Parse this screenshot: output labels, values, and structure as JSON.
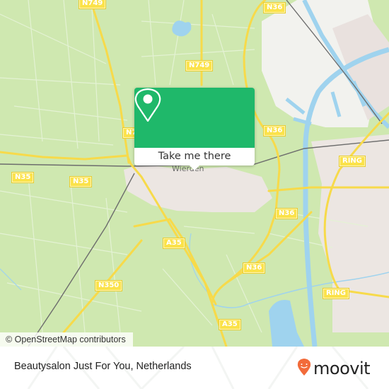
{
  "map": {
    "attribution": "© OpenStreetMap contributors",
    "town_label": "Wierden",
    "road_labels": [
      {
        "id": "n749-top-left",
        "text": "N749"
      },
      {
        "id": "n749-center",
        "text": "N749"
      },
      {
        "id": "n36-top",
        "text": "N36"
      },
      {
        "id": "n7-left",
        "text": "N7"
      },
      {
        "id": "n36-mid",
        "text": "N36"
      },
      {
        "id": "n35-left",
        "text": "N35"
      },
      {
        "id": "n35-center",
        "text": "N35"
      },
      {
        "id": "ring-right",
        "text": "RING"
      },
      {
        "id": "n36-lower",
        "text": "N36"
      },
      {
        "id": "a35-center",
        "text": "A35"
      },
      {
        "id": "n36-south",
        "text": "N36"
      },
      {
        "id": "n350",
        "text": "N350"
      },
      {
        "id": "ring-lower",
        "text": "RING"
      },
      {
        "id": "a35-south",
        "text": "A35"
      }
    ],
    "colors": {
      "land": "#cfe8b0",
      "urban": "#ece6e2",
      "water": "#9fd3ee",
      "road": "#f7da4a",
      "rail": "#6d6d6d"
    }
  },
  "popup": {
    "icon": "map-pin-icon",
    "action_label": "Take me there",
    "accent_color": "#1fb86a"
  },
  "footer": {
    "place_title": "Beautysalon Just For You, Netherlands",
    "brand_name": "moovit",
    "brand_color": "#f26b3a"
  }
}
